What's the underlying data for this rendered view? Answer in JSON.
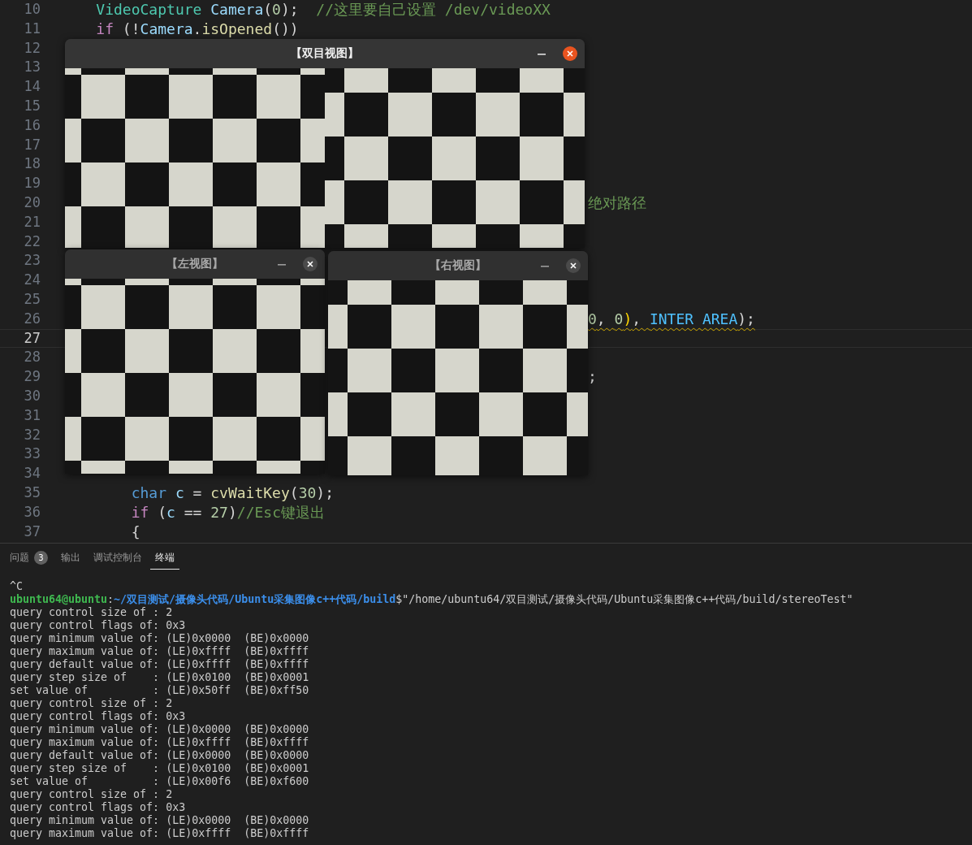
{
  "editor": {
    "lines": [
      {
        "number": "10",
        "current": false,
        "kind": "code",
        "tokens": [
          {
            "text": "    VideoCapture",
            "kind": "type"
          },
          {
            "text": " Camera",
            "kind": "var"
          },
          {
            "text": "(",
            "kind": "plain"
          },
          {
            "text": "0",
            "kind": "number"
          },
          {
            "text": ");  ",
            "kind": "plain"
          },
          {
            "text": "//这里要自己设置 /dev/videoXX",
            "kind": "comment"
          }
        ]
      },
      {
        "number": "11",
        "current": false,
        "kind": "code",
        "tokens": [
          {
            "text": "    if",
            "kind": "control"
          },
          {
            "text": " (!",
            "kind": "plain"
          },
          {
            "text": "Camera",
            "kind": "var"
          },
          {
            "text": ".",
            "kind": "plain"
          },
          {
            "text": "isOpened",
            "kind": "func"
          },
          {
            "text": "())",
            "kind": "plain"
          }
        ]
      },
      {
        "number": "12",
        "current": false
      },
      {
        "number": "13",
        "current": false
      },
      {
        "number": "14",
        "current": false
      },
      {
        "number": "15",
        "current": false
      },
      {
        "number": "16",
        "current": false
      },
      {
        "number": "17",
        "current": false
      },
      {
        "number": "18",
        "current": false
      },
      {
        "number": "19",
        "current": false
      },
      {
        "number": "20",
        "current": false,
        "kind": "behind",
        "tokens": [
          {
            "text": "绝对路径",
            "kind": "comment"
          }
        ]
      },
      {
        "number": "21",
        "current": false
      },
      {
        "number": "22",
        "current": false
      },
      {
        "number": "23",
        "current": false
      },
      {
        "number": "24",
        "current": false
      },
      {
        "number": "25",
        "current": false
      },
      {
        "number": "26",
        "current": false,
        "kind": "behind",
        "warning": true,
        "tokens": [
          {
            "text": "0",
            "kind": "number"
          },
          {
            "text": ", ",
            "kind": "plain"
          },
          {
            "text": "0",
            "kind": "number"
          },
          {
            "text": ")",
            "kind": "bracket"
          },
          {
            "text": ", ",
            "kind": "plain"
          },
          {
            "text": "INTER AREA",
            "kind": "enum"
          },
          {
            "text": ");",
            "kind": "plain"
          }
        ]
      },
      {
        "number": "27",
        "current": true
      },
      {
        "number": "28",
        "current": false
      },
      {
        "number": "29",
        "current": false,
        "kind": "behind",
        "tokens": [
          {
            "text": ";",
            "kind": "plain"
          }
        ]
      },
      {
        "number": "30",
        "current": false
      },
      {
        "number": "31",
        "current": false
      },
      {
        "number": "32",
        "current": false
      },
      {
        "number": "33",
        "current": false
      },
      {
        "number": "34",
        "current": false
      },
      {
        "number": "35",
        "current": false,
        "kind": "code",
        "tokens": [
          {
            "text": "        char",
            "kind": "keyword"
          },
          {
            "text": " c",
            "kind": "var"
          },
          {
            "text": " = ",
            "kind": "plain"
          },
          {
            "text": "cvWaitKey",
            "kind": "func"
          },
          {
            "text": "(",
            "kind": "plain"
          },
          {
            "text": "30",
            "kind": "number"
          },
          {
            "text": ");",
            "kind": "plain"
          }
        ]
      },
      {
        "number": "36",
        "current": false,
        "kind": "code",
        "tokens": [
          {
            "text": "        if",
            "kind": "control"
          },
          {
            "text": " (",
            "kind": "plain"
          },
          {
            "text": "c",
            "kind": "var"
          },
          {
            "text": " == ",
            "kind": "plain"
          },
          {
            "text": "27",
            "kind": "number"
          },
          {
            "text": ")",
            "kind": "plain"
          },
          {
            "text": "//Esc键退出",
            "kind": "comment"
          }
        ]
      },
      {
        "number": "37",
        "current": false,
        "kind": "code",
        "tokens": [
          {
            "text": "        {",
            "kind": "plain"
          }
        ]
      }
    ]
  },
  "windows": [
    {
      "title": "【双目视图】",
      "active": true,
      "kind": "stereo"
    },
    {
      "title": "【左视图】",
      "active": false,
      "kind": "single"
    },
    {
      "title": "【右视图】",
      "active": false,
      "kind": "single"
    }
  ],
  "panel": {
    "tabs": [
      {
        "label": "问题",
        "badge": "3",
        "selected": false
      },
      {
        "label": "输出",
        "selected": false
      },
      {
        "label": "调试控制台",
        "selected": false
      },
      {
        "label": "终端",
        "selected": true
      }
    ],
    "terminal": {
      "lines": [
        {
          "kind": "output",
          "text": "^C"
        },
        {
          "kind": "prompt",
          "user": "ubuntu64@ubuntu",
          "separator": ":",
          "path": "~/双目测试/摄像头代码/Ubuntu采集图像c++代码/build",
          "sign": "$",
          "command": "\"/home/ubuntu64/双目测试/摄像头代码/Ubuntu采集图像c++代码/build/stereoTest\""
        },
        {
          "kind": "output",
          "text": "query control size of : 2"
        },
        {
          "kind": "output",
          "text": "query control flags of: 0x3"
        },
        {
          "kind": "output",
          "text": "query minimum value of: (LE)0x0000  (BE)0x0000"
        },
        {
          "kind": "output",
          "text": "query maximum value of: (LE)0xffff  (BE)0xffff"
        },
        {
          "kind": "output",
          "text": "query default value of: (LE)0xffff  (BE)0xffff"
        },
        {
          "kind": "output",
          "text": "query step size of    : (LE)0x0100  (BE)0x0001"
        },
        {
          "kind": "output",
          "text": "set value of          : (LE)0x50ff  (BE)0xff50"
        },
        {
          "kind": "output",
          "text": "query control size of : 2"
        },
        {
          "kind": "output",
          "text": "query control flags of: 0x3"
        },
        {
          "kind": "output",
          "text": "query minimum value of: (LE)0x0000  (BE)0x0000"
        },
        {
          "kind": "output",
          "text": "query maximum value of: (LE)0xffff  (BE)0xffff"
        },
        {
          "kind": "output",
          "text": "query default value of: (LE)0x0000  (BE)0x0000"
        },
        {
          "kind": "output",
          "text": "query step size of    : (LE)0x0100  (BE)0x0001"
        },
        {
          "kind": "output",
          "text": "set value of          : (LE)0x00f6  (BE)0xf600"
        },
        {
          "kind": "output",
          "text": "query control size of : 2"
        },
        {
          "kind": "output",
          "text": "query control flags of: 0x3"
        },
        {
          "kind": "output",
          "text": "query minimum value of: (LE)0x0000  (BE)0x0000"
        },
        {
          "kind": "output",
          "text": "query maximum value of: (LE)0xffff  (BE)0xffff"
        }
      ]
    }
  }
}
